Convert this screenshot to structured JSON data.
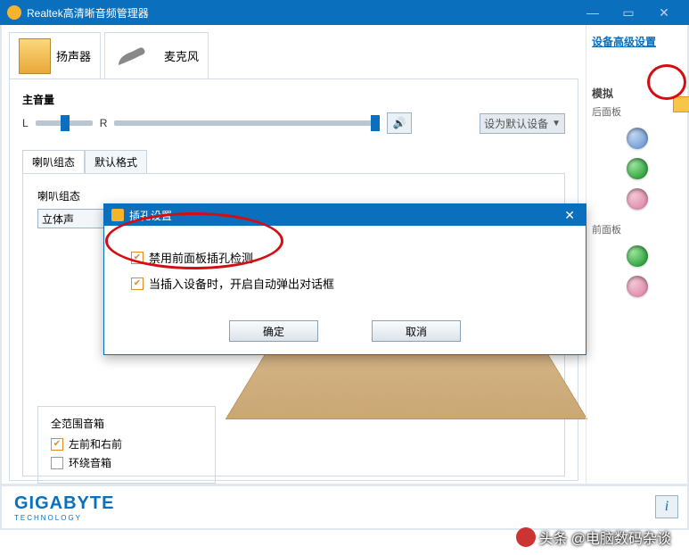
{
  "window": {
    "title": "Realtek高清晰音频管理器"
  },
  "tabs": {
    "speakers": "扬声器",
    "mic": "麦克风"
  },
  "volume": {
    "label": "主音量",
    "L": "L",
    "R": "R",
    "default_btn": "设为默认设备"
  },
  "subtabs": {
    "config": "喇叭组态",
    "format": "默认格式"
  },
  "config": {
    "label": "喇叭组态",
    "select_value": "立体声"
  },
  "range": {
    "title": "全范围音箱",
    "front": "左前和右前",
    "surround": "环绕音箱"
  },
  "modal": {
    "title": "插孔设置",
    "opt1": "禁用前面板插孔检测",
    "opt2": "当插入设备时，开启自动弹出对话框",
    "ok": "确定",
    "cancel": "取消"
  },
  "side": {
    "adv_link": "设备高级设置",
    "analog": "模拟",
    "rear": "后面板",
    "front": "前面板"
  },
  "footer": {
    "brand": "GIGABYTE",
    "sub": "TECHNOLOGY"
  },
  "watermark": {
    "prefix": "头条",
    "handle": "@电脑数码杂谈"
  }
}
